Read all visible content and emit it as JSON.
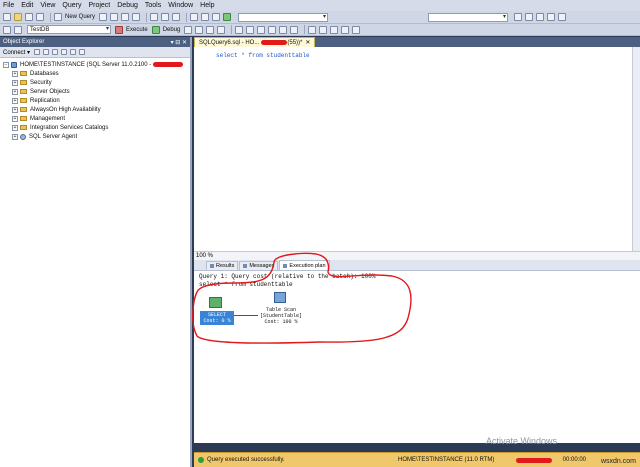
{
  "menu": [
    "File",
    "Edit",
    "View",
    "Query",
    "Project",
    "Debug",
    "Tools",
    "Window",
    "Help"
  ],
  "toolbar": {
    "new_query": "New Query",
    "database": "TestDB",
    "execute": "Execute",
    "debug": "Debug"
  },
  "object_explorer": {
    "title": "Object Explorer",
    "pin": "▾ ⊟ ✕",
    "connect": "Connect ▾",
    "server": "HOME\\TESTINSTANCE (SQL Server 11.0.2100 -",
    "nodes": [
      "Databases",
      "Security",
      "Server Objects",
      "Replication",
      "AlwaysOn High Availability",
      "Management",
      "Integration Services Catalogs",
      "SQL Server Agent"
    ]
  },
  "editor": {
    "tab_label": "SQLQuery6.sql - HO...",
    "tab_suffix": "(55))*",
    "code": "select * from studenttable",
    "zoom": "100 %"
  },
  "results_tabs": {
    "results": "Results",
    "messages": "Messages",
    "plan": "Execution plan"
  },
  "plan": {
    "line1": "Query 1: Query cost (relative to the batch): 100%",
    "line2": "select * from studenttable",
    "select_label": "SELECT",
    "select_cost": "Cost: 0 %",
    "scan_l1": "Table Scan",
    "scan_l2": "[StudentTable]",
    "scan_l3": "Cost: 100 %"
  },
  "status": {
    "message": "Query executed successfully.",
    "server": "HOME\\TESTINSTANCE (11.0 RTM)",
    "duration": "00:00:00"
  },
  "watermark": "Activate Windows",
  "site": "wsxdn.com",
  "colors": {
    "highlight": "#e2191b",
    "statusbar": "#f0c76a",
    "select_node": "#3a84d8"
  }
}
